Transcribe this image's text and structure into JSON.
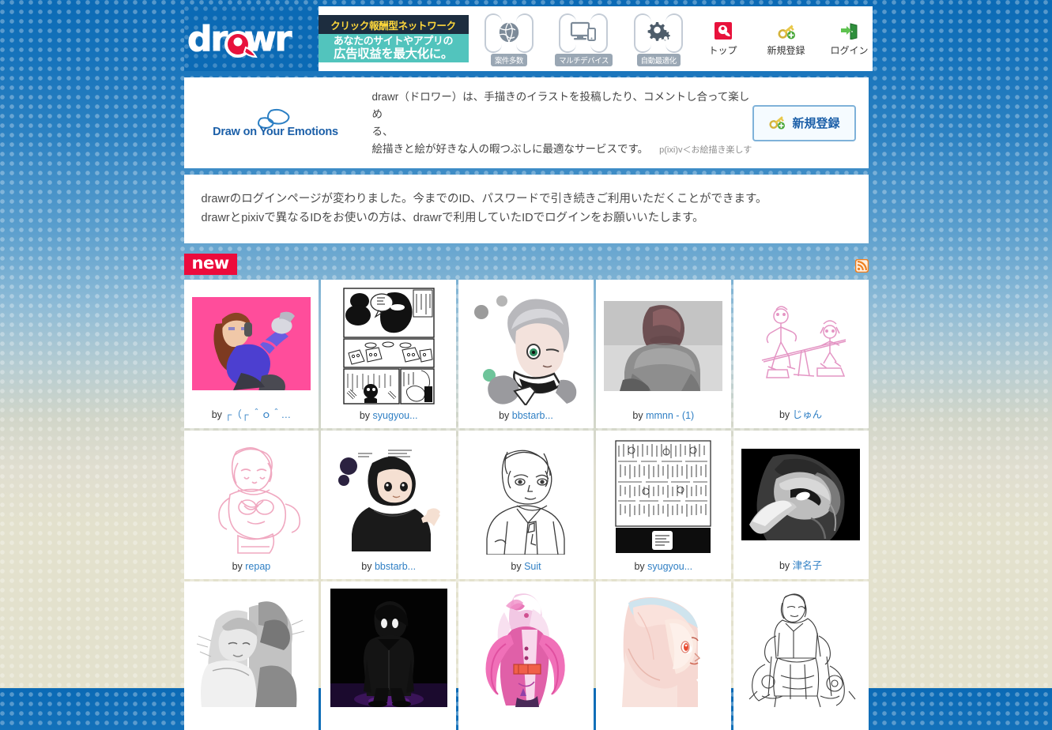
{
  "site": {
    "logo_text": "drawr",
    "brand_color": "#0b6ab5"
  },
  "ad": {
    "headline": "クリック報酬型ネットワーク",
    "line1": "あなたのサイトやアプリの",
    "line2": "広告収益を最大化に。",
    "features": [
      {
        "icon": "globe-icon",
        "label": "案件多数"
      },
      {
        "icon": "multi-device-icon",
        "label": "マルチデバイス"
      },
      {
        "icon": "gears-icon",
        "label": "自動最適化"
      }
    ]
  },
  "nav": {
    "items": [
      {
        "icon": "drawr-top-icon",
        "label": "トップ"
      },
      {
        "icon": "key-add-icon",
        "label": "新規登録"
      },
      {
        "icon": "login-door-icon",
        "label": "ログイン"
      }
    ]
  },
  "intro": {
    "tagline": "Draw on Your Emotions",
    "line1": "drawr（ドロワー）は、手描きのイラストを投稿したり、コメントし合って楽しめ",
    "line2": "る、",
    "line3": "絵描きと絵が好きな人の暇つぶしに最適なサービスです。",
    "kaomoji": "p(ixi)v＜お絵描き楽しす",
    "register_button": "新規登録"
  },
  "notice": {
    "line1": "drawrのログインページが変わりました。今までのID、パスワードで引き続きご利用いただくことができます。",
    "line2": "drawrとpixivで異なるIDをお使いの方は、drawrで利用していたIDでログインをお願いいたします。"
  },
  "new_section": {
    "badge": "new",
    "rss_icon": "rss-icon",
    "rss_color": "#f08020"
  },
  "gallery": {
    "by_prefix": "by ",
    "items": [
      {
        "author": "┌（┌ ＾ｏ＾…",
        "art": "girl-pink-bg"
      },
      {
        "author": "syugyou...",
        "art": "manga-panels"
      },
      {
        "author": "bbstarb...",
        "art": "grey-haired-boy"
      },
      {
        "author": "mmnn - (1)",
        "art": "grey-figure-sitting"
      },
      {
        "author": "じゅん",
        "art": "pink-lineart-seesaw"
      },
      {
        "author": "repap",
        "art": "pink-lineart-girl"
      },
      {
        "author": "bbstarb...",
        "art": "black-hair-boy"
      },
      {
        "author": "Suit",
        "art": "lineart-suit-boy"
      },
      {
        "author": "syugyou...",
        "art": "manga-crowd"
      },
      {
        "author": "津名子",
        "art": "plague-doctor-mask"
      },
      {
        "author": "",
        "art": "grey-couple"
      },
      {
        "author": "",
        "art": "dark-figure"
      },
      {
        "author": "",
        "art": "pink-magical-girl"
      },
      {
        "author": "",
        "art": "pink-hair-profile"
      },
      {
        "author": "",
        "art": "lineart-mecha-girl"
      }
    ]
  }
}
